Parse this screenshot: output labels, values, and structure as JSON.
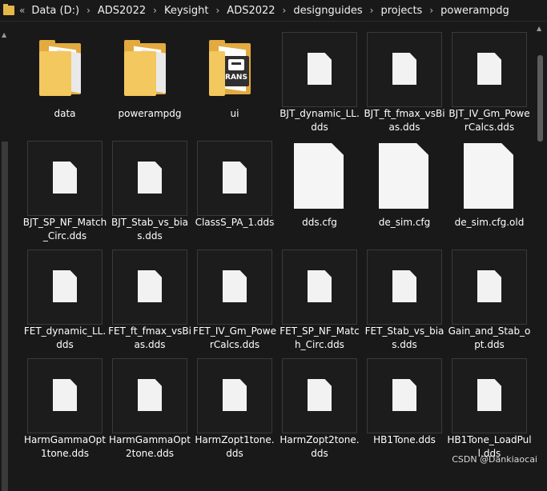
{
  "address_bar": {
    "overflow_chevron": "«",
    "separator": "›",
    "crumbs": [
      "Data (D:)",
      "ADS2022",
      "Keysight",
      "ADS2022",
      "designguides",
      "projects",
      "powerampdg"
    ]
  },
  "items": [
    {
      "name": "data",
      "type": "folder"
    },
    {
      "name": "powerampdg",
      "type": "folder"
    },
    {
      "name": "ui",
      "type": "folder-with-preview",
      "preview_text": "RANS"
    },
    {
      "name": "BJT_dynamic_LL.dds",
      "type": "file-thumb"
    },
    {
      "name": "BJT_ft_fmax_vsBias.dds",
      "type": "file-thumb"
    },
    {
      "name": "BJT_IV_Gm_PowerCalcs.dds",
      "type": "file-thumb"
    },
    {
      "name": "BJT_SP_NF_Match_Circ.dds",
      "type": "file-thumb"
    },
    {
      "name": "BJT_Stab_vs_bias.dds",
      "type": "file-thumb"
    },
    {
      "name": "ClassS_PA_1.dds",
      "type": "file-thumb"
    },
    {
      "name": "dds.cfg",
      "type": "file-plain"
    },
    {
      "name": "de_sim.cfg",
      "type": "file-plain"
    },
    {
      "name": "de_sim.cfg.old",
      "type": "file-plain"
    },
    {
      "name": "FET_dynamic_LL.dds",
      "type": "file-thumb"
    },
    {
      "name": "FET_ft_fmax_vsBias.dds",
      "type": "file-thumb"
    },
    {
      "name": "FET_IV_Gm_PowerCalcs.dds",
      "type": "file-thumb"
    },
    {
      "name": "FET_SP_NF_Match_Circ.dds",
      "type": "file-thumb"
    },
    {
      "name": "FET_Stab_vs_bias.dds",
      "type": "file-thumb"
    },
    {
      "name": "Gain_and_Stab_opt.dds",
      "type": "file-thumb"
    },
    {
      "name": "HarmGammaOpt1tone.dds",
      "type": "file-thumb"
    },
    {
      "name": "HarmGammaOpt2tone.dds",
      "type": "file-thumb"
    },
    {
      "name": "HarmZopt1tone.dds",
      "type": "file-thumb"
    },
    {
      "name": "HarmZopt2tone.dds",
      "type": "file-thumb"
    },
    {
      "name": "HB1Tone.dds",
      "type": "file-thumb"
    },
    {
      "name": "HB1Tone_LoadPull.dds",
      "type": "file-thumb"
    }
  ],
  "watermark": "CSDN @Dankiaocai",
  "colors": {
    "background": "#191919",
    "folder": "#e3aa3f",
    "text": "#ffffff"
  }
}
